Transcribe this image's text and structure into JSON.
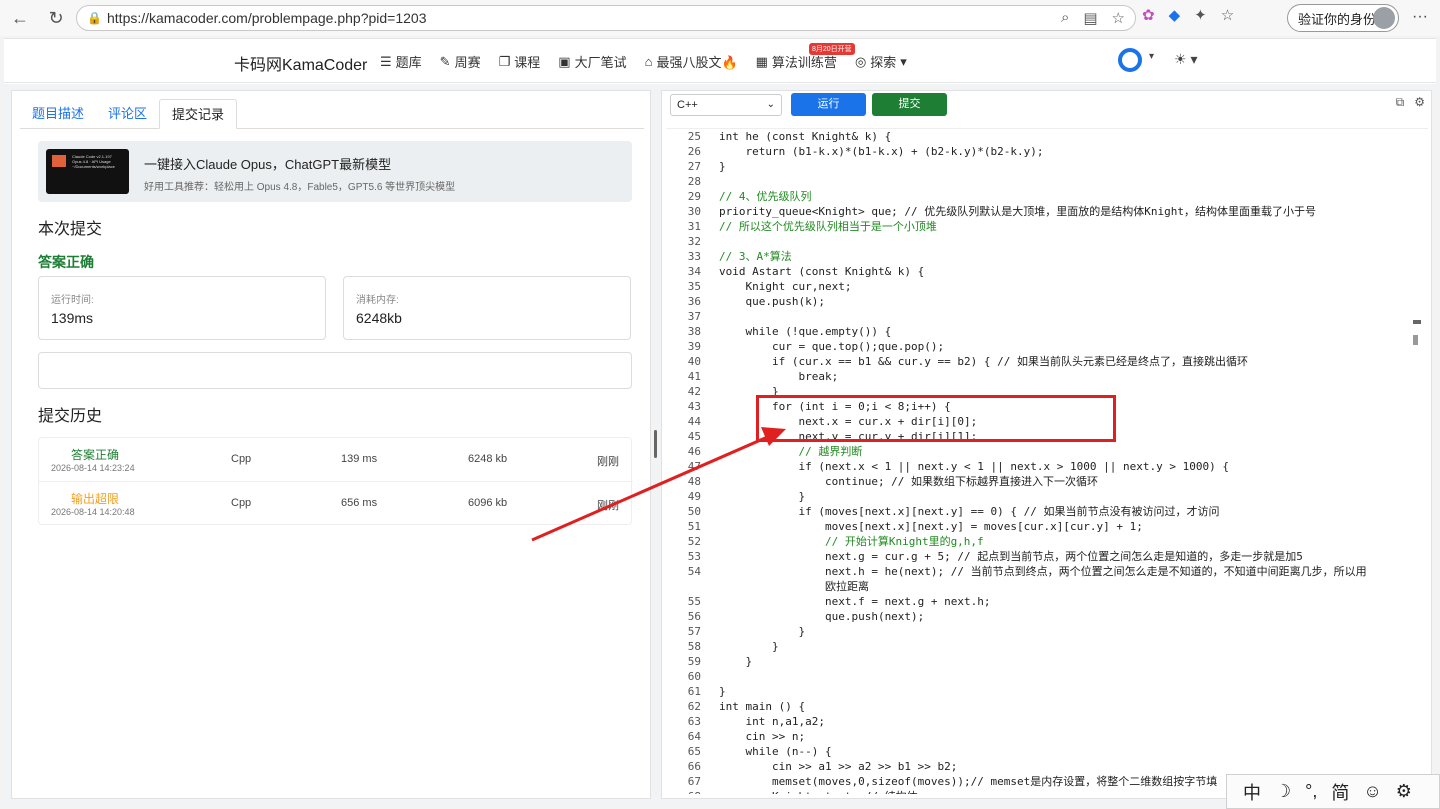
{
  "browser": {
    "url": "https://kamacoder.com/problempage.php?pid=1203",
    "verify_label": "验证你的身份"
  },
  "nav": {
    "brand": "卡码网KamaCoder",
    "items": [
      "题库",
      "周赛",
      "课程",
      "大厂笔试",
      "最强八股文🔥",
      "算法训练营",
      "探索"
    ],
    "badge": "8月20日开营"
  },
  "left": {
    "tabs": [
      "题目描述",
      "评论区",
      "提交记录"
    ],
    "ad_title": "一键接入Claude Opus，ChatGPT最新模型",
    "ad_sub": "好用工具推荐：轻松用上 Opus 4.8，Fable5，GPT5.6 等世界顶尖模型",
    "ad_thumb_text": "Claude Code v2.1.197\nOpus 4.8 · API Usage\n~/Documents/workplace",
    "this_submit": "本次提交",
    "result": "答案正确",
    "runtime_label": "运行时间:",
    "runtime_value": "139ms",
    "memory_label": "消耗内存:",
    "memory_value": "6248kb",
    "history_title": "提交历史",
    "history": [
      {
        "status": "答案正确",
        "date": "2026-08-14 14:23:24",
        "lang": "Cpp",
        "time": "139 ms",
        "mem": "6248 kb",
        "ago": "刚刚",
        "color": "#1e7e34"
      },
      {
        "status": "输出超限",
        "date": "2026-08-14 14:20:48",
        "lang": "Cpp",
        "time": "656 ms",
        "mem": "6096 kb",
        "ago": "刚刚",
        "color": "#f0a020"
      }
    ]
  },
  "editor": {
    "language": "C++",
    "run_label": "运行",
    "submit_label": "提交",
    "lines": [
      {
        "n": "25",
        "t": "int he (const Knight& k) {"
      },
      {
        "n": "26",
        "t": "    return (b1-k.x)*(b1-k.x) + (b2-k.y)*(b2-k.y);"
      },
      {
        "n": "27",
        "t": "}"
      },
      {
        "n": "28",
        "t": ""
      },
      {
        "n": "29",
        "t": "// 4、优先级队列"
      },
      {
        "n": "30",
        "t": "priority_queue<Knight> que; // 优先级队列默认是大顶堆，里面放的是结构体Knight，结构体里面重载了小于号"
      },
      {
        "n": "31",
        "t": "// 所以这个优先级队列相当于是一个小顶堆"
      },
      {
        "n": "32",
        "t": ""
      },
      {
        "n": "33",
        "t": "// 3、A*算法"
      },
      {
        "n": "34",
        "t": "void Astart (const Knight& k) {"
      },
      {
        "n": "35",
        "t": "    Knight cur,next;"
      },
      {
        "n": "36",
        "t": "    que.push(k);"
      },
      {
        "n": "37",
        "t": ""
      },
      {
        "n": "38",
        "t": "    while (!que.empty()) {"
      },
      {
        "n": "39",
        "t": "        cur = que.top();que.pop();"
      },
      {
        "n": "40",
        "t": "        if (cur.x == b1 && cur.y == b2) { // 如果当前队头元素已经是终点了，直接跳出循环"
      },
      {
        "n": "41",
        "t": "            break;"
      },
      {
        "n": "42",
        "t": "        }"
      },
      {
        "n": "43",
        "t": "        for (int i = 0;i < 8;i++) {"
      },
      {
        "n": "44",
        "t": "            next.x = cur.x + dir[i][0];"
      },
      {
        "n": "45",
        "t": "            next.y = cur.y + dir[i][1];"
      },
      {
        "n": "46",
        "t": "            // 越界判断"
      },
      {
        "n": "47",
        "t": "            if (next.x < 1 || next.y < 1 || next.x > 1000 || next.y > 1000) {"
      },
      {
        "n": "48",
        "t": "                continue; // 如果数组下标越界直接进入下一次循环"
      },
      {
        "n": "49",
        "t": "            }"
      },
      {
        "n": "50",
        "t": "            if (moves[next.x][next.y] == 0) { // 如果当前节点没有被访问过，才访问"
      },
      {
        "n": "51",
        "t": "                moves[next.x][next.y] = moves[cur.x][cur.y] + 1;"
      },
      {
        "n": "52",
        "t": "                // 开始计算Knight里的g,h,f"
      },
      {
        "n": "53",
        "t": "                next.g = cur.g + 5; // 起点到当前节点，两个位置之间怎么走是知道的，多走一步就是加5"
      },
      {
        "n": "54",
        "t": "                next.h = he(next); // 当前节点到终点，两个位置之间怎么走是不知道的，不知道中间距离几步，所以用"
      },
      {
        "n": "",
        "t": "                欧拉距离"
      },
      {
        "n": "55",
        "t": "                next.f = next.g + next.h;"
      },
      {
        "n": "56",
        "t": "                que.push(next);"
      },
      {
        "n": "57",
        "t": "            }"
      },
      {
        "n": "58",
        "t": "        }"
      },
      {
        "n": "59",
        "t": "    }"
      },
      {
        "n": "60",
        "t": ""
      },
      {
        "n": "61",
        "t": "}"
      },
      {
        "n": "62",
        "t": "int main () {"
      },
      {
        "n": "63",
        "t": "    int n,a1,a2;"
      },
      {
        "n": "64",
        "t": "    cin >> n;"
      },
      {
        "n": "65",
        "t": "    while (n--) {"
      },
      {
        "n": "66",
        "t": "        cin >> a1 >> a2 >> b1 >> b2;"
      },
      {
        "n": "67",
        "t": "        memset(moves,0,sizeof(moves));// memset是内存设置，将整个二维数组按字节填"
      },
      {
        "n": "68",
        "t": "        Knight start; // 结构体"
      }
    ]
  },
  "ime": {
    "items": [
      "中",
      "☽",
      "°,",
      "简",
      "☺",
      "⚙"
    ]
  }
}
